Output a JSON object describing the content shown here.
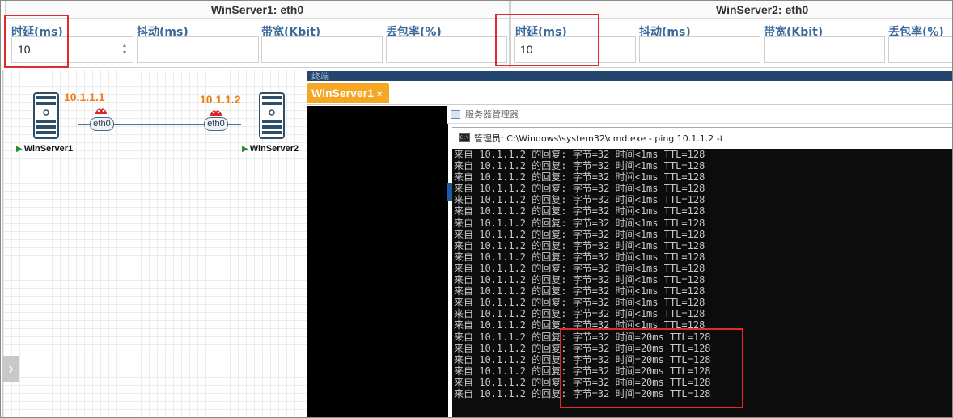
{
  "panels": [
    {
      "title": "WinServer1: eth0",
      "fields": [
        {
          "label": "时延(ms)",
          "value": "10"
        },
        {
          "label": "抖动(ms)",
          "value": ""
        },
        {
          "label": "带宽(Kbit)",
          "value": ""
        },
        {
          "label": "丢包率(%)",
          "value": ""
        }
      ]
    },
    {
      "title": "WinServer2: eth0",
      "fields": [
        {
          "label": "时延(ms)",
          "value": "10"
        },
        {
          "label": "抖动(ms)",
          "value": ""
        },
        {
          "label": "带宽(Kbit)",
          "value": ""
        },
        {
          "label": "丢包率(%)",
          "value": ""
        }
      ]
    }
  ],
  "topology": {
    "server1": {
      "name": "WinServer1",
      "ip": "10.1.1.1",
      "iface": "eth0"
    },
    "server2": {
      "name": "WinServer2",
      "ip": "10.1.1.2",
      "iface": "eth0"
    }
  },
  "terminal": {
    "header_text": "终端",
    "tab_label": "WinServer1",
    "tab_close": "×",
    "server_manager_title": "服务器管理器",
    "cmd_title": "管理员: C:\\Windows\\system32\\cmd.exe - ping  10.1.1.2 -t",
    "cmd_icon_text": "C:\\",
    "lines": [
      "来自 10.1.1.2 的回复: 字节=32 时间<1ms TTL=128",
      "来自 10.1.1.2 的回复: 字节=32 时间<1ms TTL=128",
      "来自 10.1.1.2 的回复: 字节=32 时间<1ms TTL=128",
      "来自 10.1.1.2 的回复: 字节=32 时间<1ms TTL=128",
      "来自 10.1.1.2 的回复: 字节=32 时间<1ms TTL=128",
      "来自 10.1.1.2 的回复: 字节=32 时间<1ms TTL=128",
      "来自 10.1.1.2 的回复: 字节=32 时间<1ms TTL=128",
      "来自 10.1.1.2 的回复: 字节=32 时间<1ms TTL=128",
      "来自 10.1.1.2 的回复: 字节=32 时间<1ms TTL=128",
      "来自 10.1.1.2 的回复: 字节=32 时间<1ms TTL=128",
      "来自 10.1.1.2 的回复: 字节=32 时间<1ms TTL=128",
      "来自 10.1.1.2 的回复: 字节=32 时间<1ms TTL=128",
      "来自 10.1.1.2 的回复: 字节=32 时间<1ms TTL=128",
      "来自 10.1.1.2 的回复: 字节=32 时间<1ms TTL=128",
      "来自 10.1.1.2 的回复: 字节=32 时间<1ms TTL=128",
      "来自 10.1.1.2 的回复: 字节=32 时间<1ms TTL=128",
      "来自 10.1.1.2 的回复: 字节=32 时间=20ms TTL=128",
      "来自 10.1.1.2 的回复: 字节=32 时间=20ms TTL=128",
      "来自 10.1.1.2 的回复: 字节=32 时间=20ms TTL=128",
      "来自 10.1.1.2 的回复: 字节=32 时间=20ms TTL=128",
      "来自 10.1.1.2 的回复: 字节=32 时间=20ms TTL=128",
      "来自 10.1.1.2 的回复: 字节=32 时间=20ms TTL=128"
    ]
  },
  "colors": {
    "highlight": "#e02b2b",
    "tab_orange": "#f5a623",
    "ip_orange": "#f07a14",
    "label_blue": "#3a6a9a"
  },
  "icons": {
    "server": "server-tower-icon",
    "traffic": "traffic-light-icon",
    "expand": "chevron-right-icon"
  }
}
